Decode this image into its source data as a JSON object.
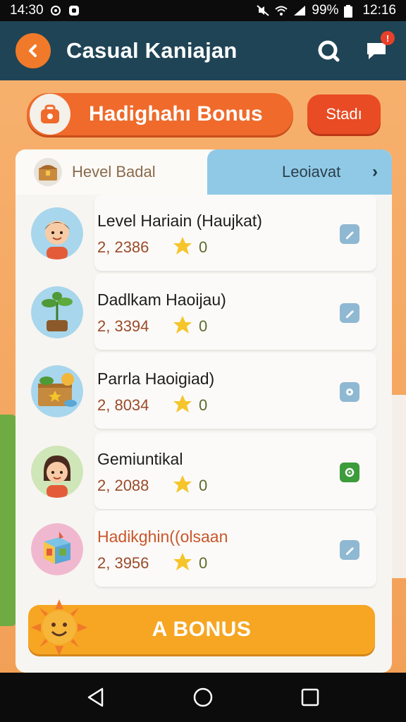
{
  "status_bar": {
    "time_left": "14:30",
    "battery": "99%",
    "clock": "12:16"
  },
  "header": {
    "title": "Casual Kaniajan"
  },
  "bonus_banner": {
    "label": "Hadighahı Bonus",
    "start_label": "Stadı"
  },
  "tabs": {
    "level": "Hevel Badal",
    "leaderboard": "Leoiavat"
  },
  "items": [
    {
      "title": "Level Hariain (Haujkat)",
      "score": "2, 2386",
      "stars": "0",
      "title_color": "#1d1d1d",
      "action": "edit"
    },
    {
      "title": "Dadlkam Haoijau)",
      "score": "2, 3394",
      "stars": "0",
      "title_color": "#1d1d1d",
      "action": "edit"
    },
    {
      "title": "Parrla Haoigiad)",
      "score": "2, 8034",
      "stars": "0",
      "title_color": "#1d1d1d",
      "action": "record"
    },
    {
      "title": "Gemiuntikal",
      "score": "2, 2088",
      "stars": "0",
      "title_color": "#1d1d1d",
      "action": "view"
    },
    {
      "title": "Hadikghin((olsaan",
      "score": "2, 3956",
      "stars": "0",
      "title_color": "#c9562a",
      "action": "edit"
    }
  ],
  "bonus_button": {
    "label": "A BONUS"
  },
  "colors": {
    "header": "#1f4455",
    "accent": "#ef6a2b",
    "tab_active": "#8fc9e6",
    "bonus": "#f6a623"
  }
}
